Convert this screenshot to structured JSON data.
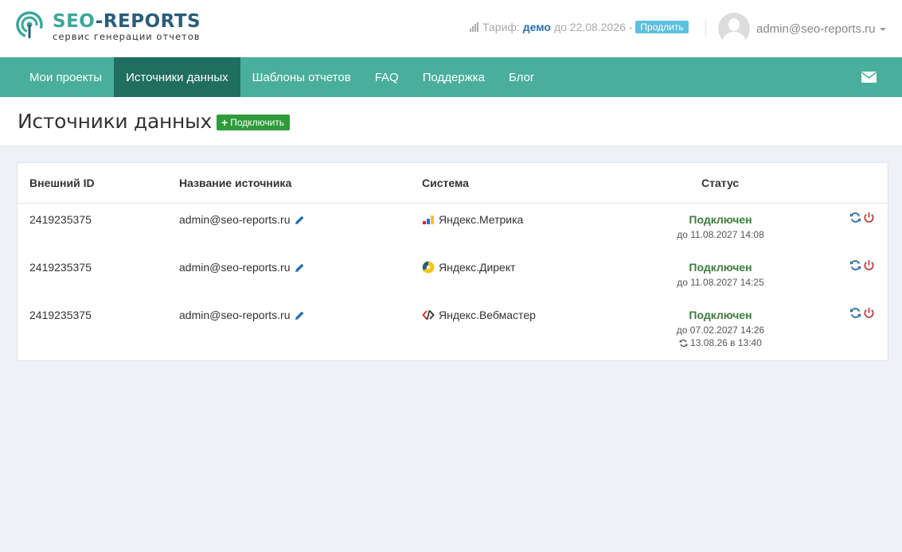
{
  "brand": {
    "name_part1": "SEO",
    "name_dash": "-",
    "name_part2": "REPORTS",
    "tagline": "сервис генерации отчетов",
    "colors": {
      "teal": "#3aa79a",
      "navy": "#2a5d7a"
    }
  },
  "tariff": {
    "label": "Тариф:",
    "plan": "демо",
    "until": "до 22.08.2026 -",
    "extend_label": "Продлить"
  },
  "user": {
    "email": "admin@seo-reports.ru"
  },
  "nav": {
    "items": [
      {
        "label": "Мои проекты"
      },
      {
        "label": "Источники данных"
      },
      {
        "label": "Шаблоны отчетов"
      },
      {
        "label": "FAQ"
      },
      {
        "label": "Поддержка"
      },
      {
        "label": "Блог"
      }
    ],
    "active_index": 1,
    "colors": {
      "bar": "#4aae9c",
      "active": "#1f6e60"
    }
  },
  "page": {
    "title": "Источники данных",
    "connect_label": "Подключить"
  },
  "table": {
    "headers": {
      "id": "Внешний ID",
      "name": "Название источника",
      "system": "Система",
      "status": "Статус"
    },
    "rows": [
      {
        "id": "2419235375",
        "name": "admin@seo-reports.ru",
        "system": "Яндекс.Метрика",
        "system_icon": "metrika-icon",
        "status": "Подключен",
        "status_date": "до 11.08.2027 14:08",
        "sync": ""
      },
      {
        "id": "2419235375",
        "name": "admin@seo-reports.ru",
        "system": "Яндекс.Директ",
        "system_icon": "direct-icon",
        "status": "Подключен",
        "status_date": "до 11.08.2027 14:25",
        "sync": ""
      },
      {
        "id": "2419235375",
        "name": "admin@seo-reports.ru",
        "system": "Яндекс.Вебмастер",
        "system_icon": "webmaster-icon",
        "status": "Подключен",
        "status_date": "до 07.02.2027 14:26",
        "sync": "13.08.26 в 13:40"
      }
    ],
    "colors": {
      "status": "#3c7d3c",
      "refresh": "#2a6fa8",
      "power": "#b94a48"
    }
  }
}
